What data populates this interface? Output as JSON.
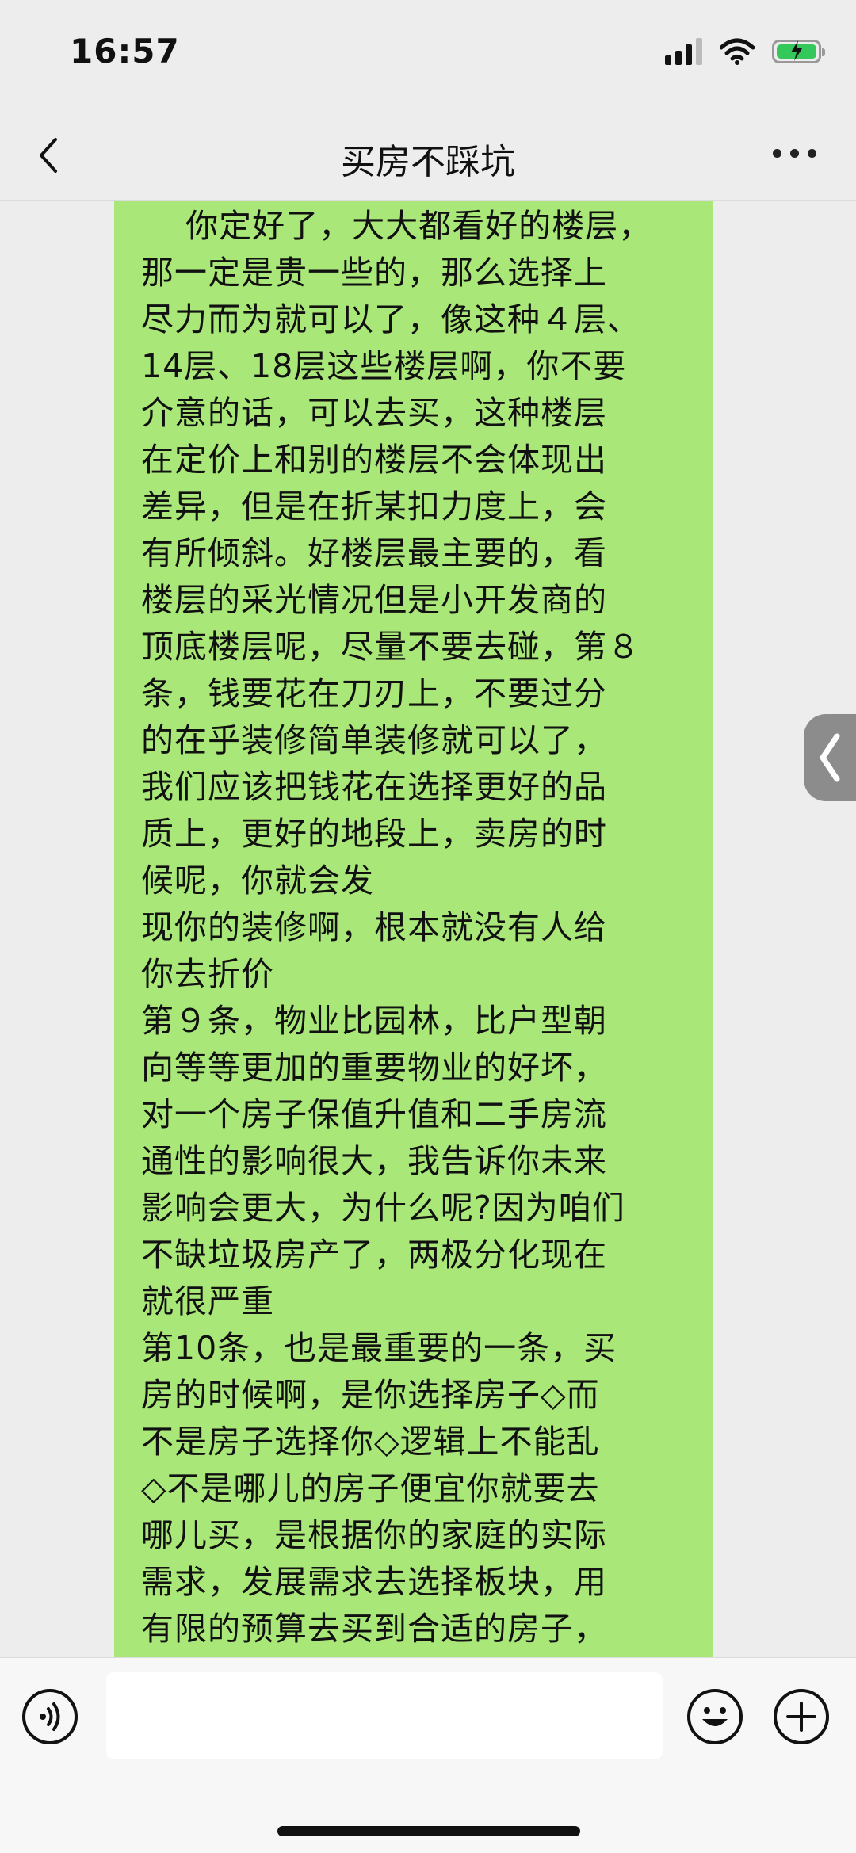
{
  "status_bar": {
    "time": "16:57",
    "battery_percent": 80,
    "battery_color": "#34c759"
  },
  "nav": {
    "title": "买房不踩坑",
    "back_icon": "chevron-left-icon",
    "more_icon": "more-dots-icon"
  },
  "chat": {
    "bubble_color": "#a9e878",
    "message": "你定好了，大大都看好的楼层，\n那一定是贵一些的，那么选择上\n尽力而为就可以了，像这种４层、\n14层、18层这些楼层啊，你不要\n介意的话，可以去买，这种楼层\n在定价上和别的楼层不会体现出\n差异，但是在折某扣力度上，会\n有所倾斜。好楼层最主要的，看\n楼层的采光情况但是小开发商的\n顶底楼层呢，尽量不要去碰，第８\n条，钱要花在刀刃上，不要过分\n的在乎装修简单装修就可以了，\n我们应该把钱花在选择更好的品\n质上，更好的地段上，卖房的时\n候呢，你就会发\n现你的装修啊，根本就没有人给\n你去折价\n第９条，物业比园林，比户型朝\n向等等更加的重要物业的好坏，\n对一个房子保值升值和二手房流\n通性的影响很大，我告诉你未来\n影响会更大，为什么呢?因为咱们\n不缺垃圾房产了，两极分化现在\n就很严重\n第10条，也是最重要的一条，买\n房的时候啊，是你选择房子◇而\n不是房子选择你◇逻辑上不能乱\n◇不是哪儿的房子便宜你就要去\n哪儿买，是根据你的家庭的实际\n需求，发展需求去选择板块，用\n有限的预算去买到合适的房子，"
  },
  "input_bar": {
    "voice_icon": "voice-icon",
    "text_value": "",
    "emoji_icon": "emoji-icon",
    "plus_icon": "plus-icon"
  }
}
